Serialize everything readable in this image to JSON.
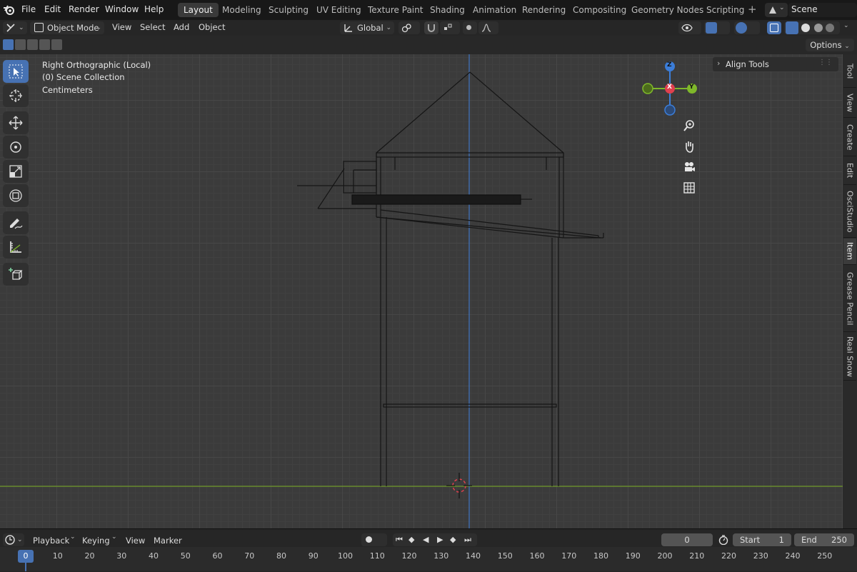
{
  "menu": [
    "File",
    "Edit",
    "Render",
    "Window",
    "Help"
  ],
  "workspaces": [
    "Layout",
    "Modeling",
    "Sculpting",
    "UV Editing",
    "Texture Paint",
    "Shading",
    "Animation",
    "Rendering",
    "Compositing",
    "Geometry Nodes",
    "Scripting"
  ],
  "scene_name": "Scene",
  "header": {
    "mode": "Object Mode",
    "menus": [
      "View",
      "Select",
      "Add",
      "Object"
    ],
    "orientation": "Global",
    "options_label": "Options"
  },
  "viewport": {
    "view_name": "Right Orthographic (Local)",
    "collection": "(0) Scene Collection",
    "units": "Centimeters",
    "axis_z": "Z",
    "axis_y": "Y",
    "axis_x": "X"
  },
  "sidebar": {
    "panel": "Align Tools",
    "tabs": [
      "Tool",
      "View",
      "Create",
      "Edit",
      "OsciStudio",
      "Item",
      "Grease Pencil",
      "Real Snow"
    ],
    "active_tab": "Item"
  },
  "timeline": {
    "menus": [
      "Playback",
      "Keying",
      "View",
      "Marker"
    ],
    "current_frame": "0",
    "start_label": "Start",
    "start_value": "1",
    "end_label": "End",
    "end_value": "250",
    "ticks": [
      "0",
      "10",
      "20",
      "30",
      "40",
      "50",
      "60",
      "70",
      "80",
      "90",
      "100",
      "110",
      "120",
      "130",
      "140",
      "150",
      "160",
      "170",
      "180",
      "190",
      "200",
      "210",
      "220",
      "230",
      "240",
      "250"
    ]
  },
  "colors": {
    "accent": "#4772b3",
    "axis_x": "#e0404e",
    "axis_y": "#7fb82a",
    "axis_z": "#3b7dd8"
  }
}
